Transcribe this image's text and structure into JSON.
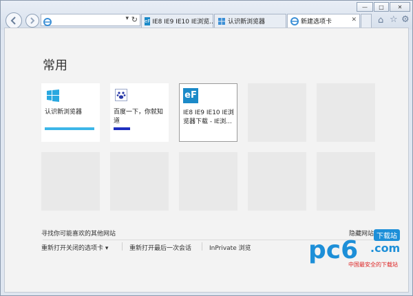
{
  "browser": {
    "address_value": "",
    "tabs": [
      {
        "label": "IE8 IE9 IE10 IE浏览..."
      },
      {
        "label": "认识新浏览器"
      },
      {
        "label": "新建选项卡"
      }
    ],
    "window_controls": {
      "minimize": "—",
      "maximize": "□",
      "close": "✕"
    }
  },
  "newtab": {
    "section_title": "常用",
    "tiles": [
      {
        "label": "认识新浏览器",
        "accent": "#3cb6e8"
      },
      {
        "label": "百度一下，你就知道",
        "accent": "#1f2fbf"
      },
      {
        "label": "IE8 IE9 IE10 IE浏览器下载 - IE浏...",
        "accent": "#1b8ac8"
      },
      {
        "label": "",
        "accent": "#e9e9e9"
      },
      {
        "label": "",
        "accent": "#e9e9e9"
      },
      {
        "label": "",
        "accent": "#e9e9e9"
      },
      {
        "label": "",
        "accent": "#e9e9e9"
      },
      {
        "label": "",
        "accent": "#e9e9e9"
      },
      {
        "label": "",
        "accent": "#e9e9e9"
      },
      {
        "label": "",
        "accent": "#e9e9e9"
      }
    ],
    "discover_link": "寻找你可能喜欢的其他网站",
    "hide_sites_link": "隐藏网站",
    "bottom_links": [
      "重新打开关闭的选项卡 ▾",
      "重新打开最后一次会话",
      "InPrivate 浏览"
    ]
  },
  "watermark": {
    "brand": "pc6",
    "sub": ".com",
    "badge": "下载站",
    "tagline": "中国最安全的下载站"
  }
}
